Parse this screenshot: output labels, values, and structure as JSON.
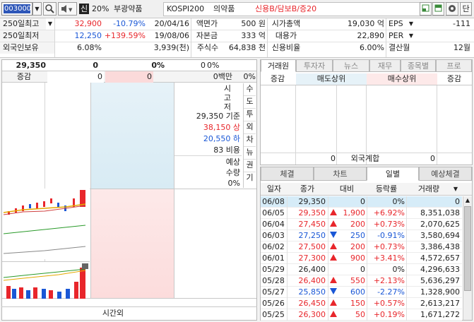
{
  "toolbar": {
    "code": "003000",
    "market_badge": "신",
    "margin_rate": "20%",
    "sector": "부광약품",
    "index": "KOSPI200",
    "industry": "의약품",
    "credit": "신용B/담보B/증20",
    "dan_label": "단"
  },
  "info": {
    "r1": {
      "label": "250일최고",
      "price": "32,900",
      "pct": "-10.79%",
      "date": "20/04/16",
      "k1": "액면가",
      "v1": "500 원",
      "k2": "시가총액",
      "v2": "19,030 억",
      "k3": "EPS",
      "v3": "-111"
    },
    "r2": {
      "label": "250일최저",
      "price": "12,250",
      "pct": "+139.59%",
      "date": "19/08/06",
      "k1": "자본금",
      "v1": "333 억",
      "k2": "대용가",
      "v2": "22,890",
      "k3": "PER",
      "v3": ""
    },
    "r3": {
      "label": "외국인보유",
      "price": "6.08%",
      "pct": "",
      "date": "3,939(천)",
      "k1": "주식수",
      "v1": "64,838 천",
      "k2": "신용비율",
      "v2": "6.00%",
      "k3": "결산월",
      "v3": "12월"
    }
  },
  "quote": {
    "price": "29,350",
    "change": "0",
    "pct": "0%",
    "volume": "0",
    "vol_pct": "0%",
    "hdr_change": "증감",
    "hdr_zero1": "0",
    "hdr_zero2": "0",
    "hdr_amount": "0백만",
    "hdr_pct": "0%"
  },
  "mid": {
    "lines": [
      "시",
      "고",
      "저"
    ],
    "base": "29,350 기준",
    "upper": "38,150 상",
    "lower": "20,550 하",
    "ratio": "83 비용",
    "expect1": "예상",
    "expect2": "수량",
    "expect_pct": "0%",
    "after_hours": "시간외"
  },
  "side_tabs": [
    "수",
    "도",
    "투",
    "외",
    "차",
    "뉴",
    "권",
    "기"
  ],
  "broker": {
    "tabs": [
      "거래원",
      "투자자",
      "뉴스",
      "재무",
      "종목별",
      "프로"
    ],
    "h_change": "증감",
    "h_sell": "매도상위",
    "h_buy": "매수상위",
    "h_change2": "증감",
    "foreign_label": "외국계합",
    "foreign_sell": "0",
    "foreign_buy": "0"
  },
  "daily": {
    "tabs": [
      "체결",
      "차트",
      "일별",
      "예상체결"
    ],
    "headers": [
      "일자",
      "종가",
      "대비",
      "등락률",
      "거래량"
    ],
    "rows": [
      {
        "date": "06/08",
        "close": "29,350",
        "dir": "",
        "diff": "0",
        "rate": "0%",
        "vol": "0",
        "cc": "",
        "rc": ""
      },
      {
        "date": "06/05",
        "close": "29,350",
        "dir": "up",
        "diff": "1,900",
        "rate": "+6.92%",
        "vol": "8,351,038",
        "cc": "red",
        "rc": "red"
      },
      {
        "date": "06/04",
        "close": "27,450",
        "dir": "up",
        "diff": "200",
        "rate": "+0.73%",
        "vol": "2,070,625",
        "cc": "red",
        "rc": "red"
      },
      {
        "date": "06/03",
        "close": "27,250",
        "dir": "dn",
        "diff": "250",
        "rate": "-0.91%",
        "vol": "3,580,694",
        "cc": "blue",
        "rc": "blue"
      },
      {
        "date": "06/02",
        "close": "27,500",
        "dir": "up",
        "diff": "200",
        "rate": "+0.73%",
        "vol": "3,386,438",
        "cc": "red",
        "rc": "red"
      },
      {
        "date": "06/01",
        "close": "27,300",
        "dir": "up",
        "diff": "900",
        "rate": "+3.41%",
        "vol": "4,572,657",
        "cc": "red",
        "rc": "red"
      },
      {
        "date": "05/29",
        "close": "26,400",
        "dir": "",
        "diff": "0",
        "rate": "0%",
        "vol": "4,296,633",
        "cc": "",
        "rc": ""
      },
      {
        "date": "05/28",
        "close": "26,400",
        "dir": "up",
        "diff": "550",
        "rate": "+2.13%",
        "vol": "5,636,297",
        "cc": "red",
        "rc": "red"
      },
      {
        "date": "05/27",
        "close": "25,850",
        "dir": "dn",
        "diff": "600",
        "rate": "-2.27%",
        "vol": "1,328,900",
        "cc": "blue",
        "rc": "blue"
      },
      {
        "date": "05/26",
        "close": "26,450",
        "dir": "up",
        "diff": "150",
        "rate": "+0.57%",
        "vol": "2,613,217",
        "cc": "red",
        "rc": "red"
      },
      {
        "date": "05/25",
        "close": "26,300",
        "dir": "up",
        "diff": "50",
        "rate": "+0.19%",
        "vol": "1,671,272",
        "cc": "red",
        "rc": "red"
      }
    ]
  }
}
